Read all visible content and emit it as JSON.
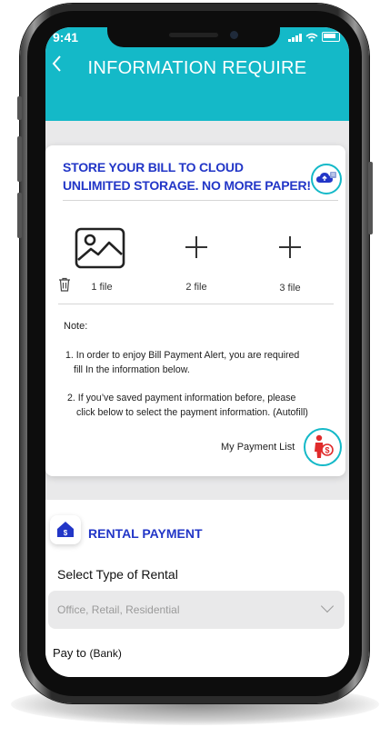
{
  "status_bar": {
    "time": "9:41"
  },
  "header": {
    "title": "INFORMATION REQUIRE",
    "back_icon": "chevron-left-icon"
  },
  "colors": {
    "header": "#14b9c8",
    "accent_text": "#2236c7"
  },
  "cloud_card": {
    "headline_1": "STORE YOUR BILL TO CLOUD",
    "headline_2": "UNLIMITED STORAGE. NO MORE PAPER!",
    "uploaders": [
      {
        "label": "1 file",
        "icon": "image-icon"
      },
      {
        "label": "2 file",
        "icon": "plus-icon"
      },
      {
        "label": "3 file",
        "icon": "plus-icon"
      }
    ],
    "note_label": "Note:",
    "notes": [
      "1. In order to enjoy Bill Payment Alert, you are required",
      "fill In the information below.",
      "2. If you’ve saved payment information before, please",
      "click below to select the payment information. (Autofill)"
    ],
    "payment_list_label": "My Payment List"
  },
  "rental": {
    "title": "RENTAL PAYMENT",
    "select_label": "Select Type of Rental",
    "select_placeholder": "Office, Retail, Residential",
    "pay_to_label": "Pay to",
    "pay_to_hint": "(Bank)"
  }
}
